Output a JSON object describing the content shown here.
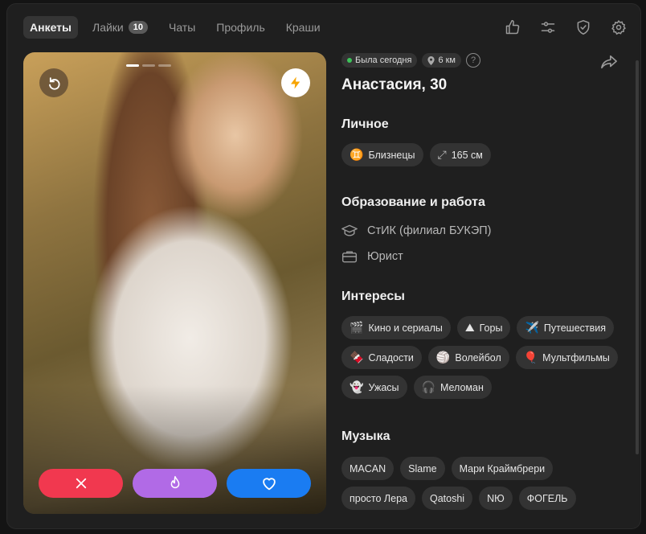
{
  "nav": {
    "tabs": [
      {
        "label": "Анкеты"
      },
      {
        "label": "Лайки",
        "badge": "10"
      },
      {
        "label": "Чаты"
      },
      {
        "label": "Профиль"
      },
      {
        "label": "Краши"
      }
    ],
    "icons": [
      "thumbs-up-icon",
      "sliders-icon",
      "shield-check-icon",
      "gear-icon"
    ]
  },
  "photo": {
    "photo_count": 3,
    "current_photo": 1
  },
  "profile": {
    "status": "Была сегодня",
    "distance": "6 км",
    "help": "?",
    "name": "Анастасия, 30"
  },
  "personal": {
    "title": "Личное",
    "chips": [
      {
        "icon": "♊",
        "label": "Близнецы"
      },
      {
        "icon": "⤢",
        "label": "165 см"
      }
    ]
  },
  "education": {
    "title": "Образование и работа",
    "school": "СтИК (филиал БУКЭП)",
    "job": "Юрист"
  },
  "interests": {
    "title": "Интересы",
    "items": [
      {
        "emoji": "🎬",
        "label": "Кино и сериалы"
      },
      {
        "emoji": "⛰",
        "label": "Горы"
      },
      {
        "emoji": "✈️",
        "label": "Путешествия"
      },
      {
        "emoji": "🍫",
        "label": "Сладости"
      },
      {
        "emoji": "🏐",
        "label": "Волейбол"
      },
      {
        "emoji": "🎈",
        "label": "Мультфильмы"
      },
      {
        "emoji": "👻",
        "label": "Ужасы"
      },
      {
        "emoji": "🎧",
        "label": "Меломан"
      }
    ]
  },
  "music": {
    "title": "Музыка",
    "artists": [
      "MACAN",
      "Slame",
      "Мари Краймбрери",
      "просто Лера",
      "Qatoshi",
      "NЮ",
      "ФОГЕЛЬ"
    ]
  },
  "colors": {
    "dislike": "#f1384f",
    "superlike": "#b16ae6",
    "like": "#1a7cf2",
    "boost": "#f7a400",
    "online": "#3dc35a"
  }
}
